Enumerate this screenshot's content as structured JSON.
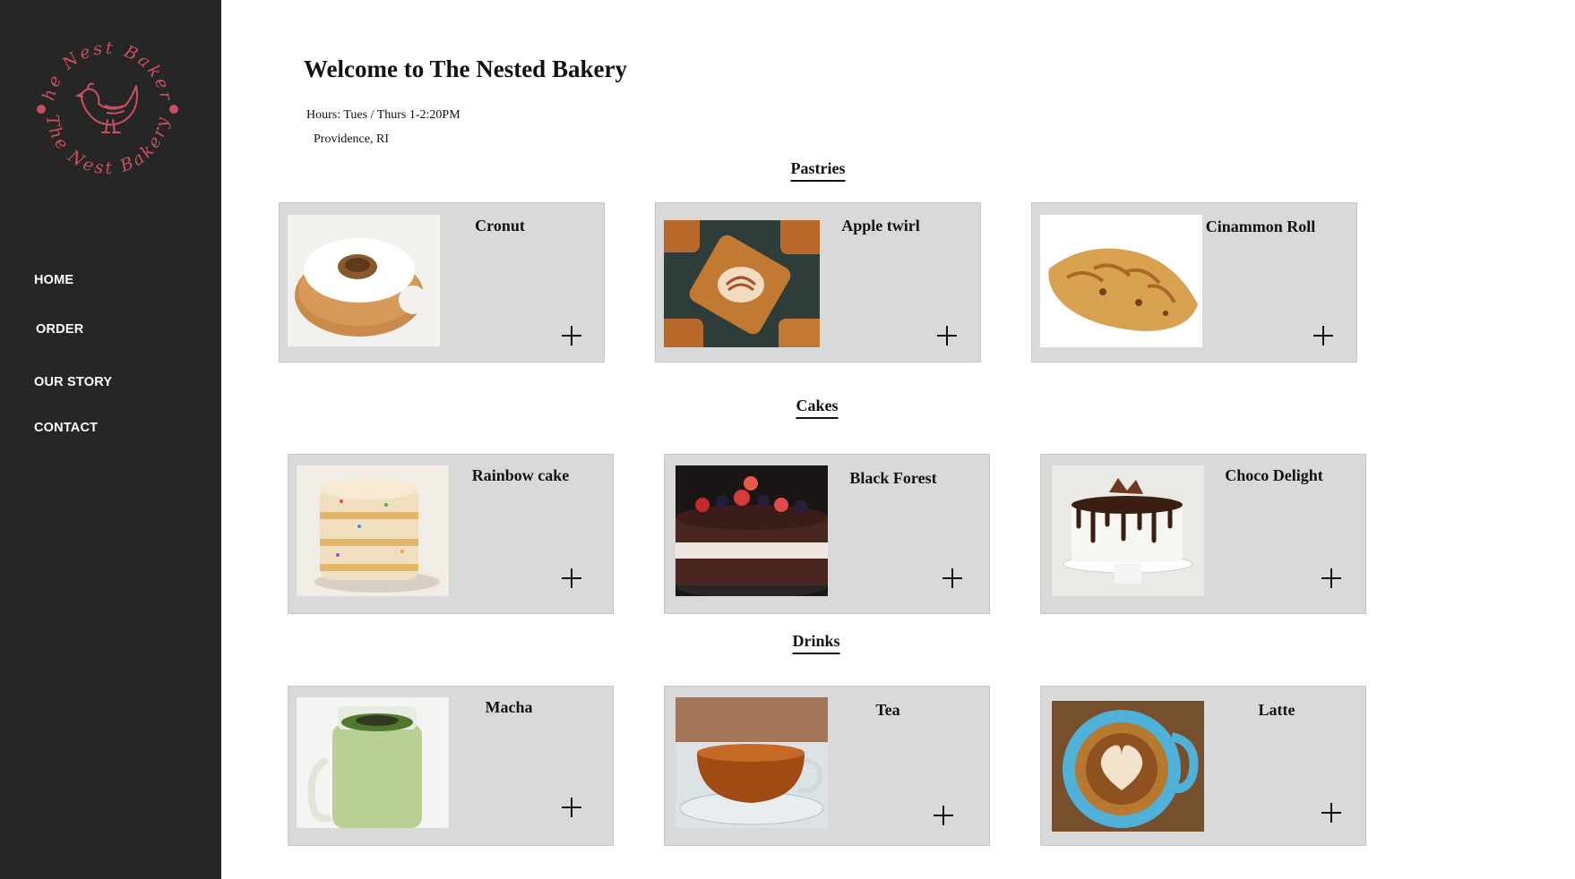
{
  "logo": {
    "text_top": "The Nest Bakery",
    "text_bottom": "The Nest Bakery",
    "color": "#c9515f",
    "icon": "hen-icon"
  },
  "nav": [
    {
      "label": "HOME"
    },
    {
      "label": "ORDER"
    },
    {
      "label": "OUR STORY"
    },
    {
      "label": "CONTACT"
    }
  ],
  "header": {
    "title": "Welcome to The Nested Bakery",
    "hours": "Hours: Tues / Thurs 1-2:20PM",
    "location": "Providence, RI"
  },
  "sections": [
    {
      "title": "Pastries",
      "items": [
        {
          "name": "Cronut",
          "icon": "cronut-photo"
        },
        {
          "name": "Apple twirl",
          "icon": "apple-twirl-photo"
        },
        {
          "name": "Cinammon Roll",
          "icon": "cinnamon-roll-photo"
        }
      ]
    },
    {
      "title": "Cakes",
      "items": [
        {
          "name": "Rainbow cake",
          "icon": "rainbow-cake-photo"
        },
        {
          "name": "Black Forest",
          "icon": "black-forest-photo"
        },
        {
          "name": "Choco Delight",
          "icon": "choco-delight-photo"
        }
      ]
    },
    {
      "title": "Drinks",
      "items": [
        {
          "name": "Macha",
          "icon": "matcha-photo"
        },
        {
          "name": "Tea",
          "icon": "tea-photo"
        },
        {
          "name": "Latte",
          "icon": "latte-photo"
        }
      ]
    }
  ],
  "colors": {
    "sidebar": "#262626",
    "card": "#d9d9d9",
    "accent": "#c9515f"
  }
}
